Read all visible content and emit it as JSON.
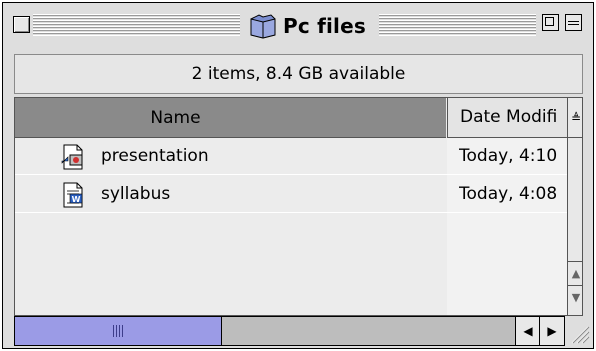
{
  "window": {
    "title": "Pc files",
    "title_icon": "folder-icon"
  },
  "info": {
    "text": "2 items, 8.4 GB available"
  },
  "columns": {
    "name": "Name",
    "date": "Date Modifi"
  },
  "files": [
    {
      "name": "presentation",
      "date": "Today, 4:10",
      "icon": "presentation-document-icon"
    },
    {
      "name": "syllabus",
      "date": "Today, 4:08",
      "icon": "word-document-icon"
    }
  ],
  "scroll": {
    "horizontal_thumb_fraction": 0.37
  },
  "colors": {
    "window_bg": "#dedede",
    "header_selected": "#8a8a8a",
    "scroll_thumb": "#9b9be6"
  }
}
